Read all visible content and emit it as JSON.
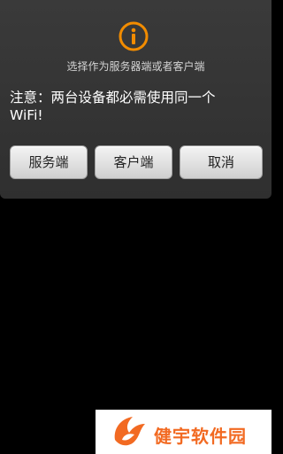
{
  "dialog": {
    "title": "选择作为服务器端或者客户端",
    "message": "注意：两台设备都必需使用同一个WiFi!",
    "icon": "info-icon",
    "accent_color": "#f28c00",
    "buttons": {
      "server_label": "服务端",
      "client_label": "客户端",
      "cancel_label": "取消"
    }
  },
  "watermark": {
    "text": "健宇软件园",
    "logo": "fox-logo",
    "color": "#f26a22"
  }
}
